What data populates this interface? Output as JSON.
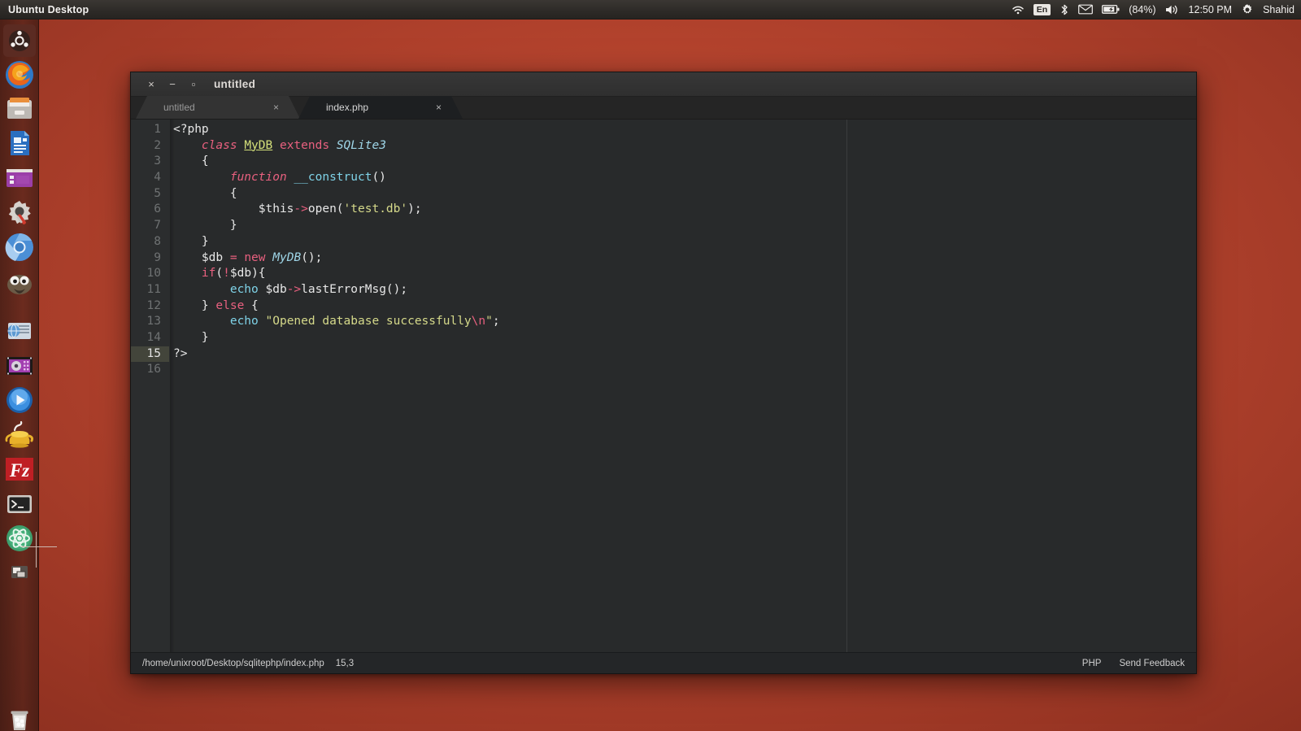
{
  "top_panel": {
    "app_menu_title": "Ubuntu Desktop",
    "indicators": {
      "wifi": "wifi-icon",
      "keyboard_layout": "En",
      "bluetooth": "bluetooth-icon",
      "mail": "mail-icon",
      "battery": "battery-icon",
      "battery_percent": "(84%)",
      "volume": "volume-icon",
      "clock": "12:50 PM",
      "session_gear": "gear-icon",
      "user_name": "Shahid"
    }
  },
  "launcher": {
    "items": [
      {
        "name": "ubuntu-dash-home",
        "label": "Dash Home",
        "running": false
      },
      {
        "name": "firefox",
        "label": "Firefox Web Browser",
        "running": false
      },
      {
        "name": "files",
        "label": "Files",
        "running": false
      },
      {
        "name": "libreoffice-writer",
        "label": "LibreOffice Writer",
        "running": false
      },
      {
        "name": "ubuntu-software",
        "label": "Ubuntu Software",
        "running": false
      },
      {
        "name": "system-settings",
        "label": "System Settings",
        "running": false
      },
      {
        "name": "chromium",
        "label": "Chromium Web Browser",
        "running": true
      },
      {
        "name": "gimp",
        "label": "GIMP Image Editor",
        "running": false
      },
      {
        "name": "help",
        "label": "Ubuntu Help",
        "running": false
      },
      {
        "name": "media-player",
        "label": "Media Player",
        "running": false
      },
      {
        "name": "video-player",
        "label": "Videos",
        "running": false
      },
      {
        "name": "geany",
        "label": "Geany",
        "running": false
      },
      {
        "name": "filezilla",
        "label": "FileZilla",
        "running": false
      },
      {
        "name": "terminal",
        "label": "Terminal",
        "running": true
      },
      {
        "name": "atom",
        "label": "Atom",
        "running": true
      },
      {
        "name": "workspace-switcher",
        "label": "Workspace Switcher",
        "running": false
      },
      {
        "name": "trash",
        "label": "Trash",
        "running": false
      }
    ]
  },
  "window": {
    "title": "untitled",
    "controls": {
      "close": "×",
      "minimize": "−",
      "maximize": "▫"
    },
    "tabs": [
      {
        "label": "untitled",
        "close": "×",
        "active": false
      },
      {
        "label": "index.php",
        "close": "×",
        "active": true
      }
    ]
  },
  "editor": {
    "line_numbers": [
      "1",
      "2",
      "3",
      "4",
      "5",
      "6",
      "7",
      "8",
      "9",
      "10",
      "11",
      "12",
      "13",
      "14",
      "15",
      "16"
    ],
    "active_line": 15,
    "lines": [
      "<?php",
      "    class MyDB extends SQLite3",
      "    {",
      "        function __construct()",
      "        {",
      "            $this->open('test.db');",
      "        }",
      "    }",
      "    $db = new MyDB();",
      "    if(!$db){",
      "        echo $db->lastErrorMsg();",
      "    } else {",
      "        echo \"Opened database successfully\\n\";",
      "    }",
      "?>",
      ""
    ]
  },
  "status_bar": {
    "file_path": "/home/unixroot/Desktop/sqlitephp/index.php",
    "cursor_position": "15,3",
    "grammar": "PHP",
    "feedback_link": "Send Feedback"
  },
  "colors": {
    "desktop_accent": "#b8452f",
    "panel_bg": "#2d2a27",
    "editor_bg": "#282a2b",
    "gutter_bg": "#2b2d2e",
    "active_line_bg": "#43453b",
    "keyword": "#e8607f",
    "class_name": "#9fd6e8",
    "function": "#7fd3e8",
    "string": "#d5d98a",
    "text": "#e7e7e7"
  }
}
